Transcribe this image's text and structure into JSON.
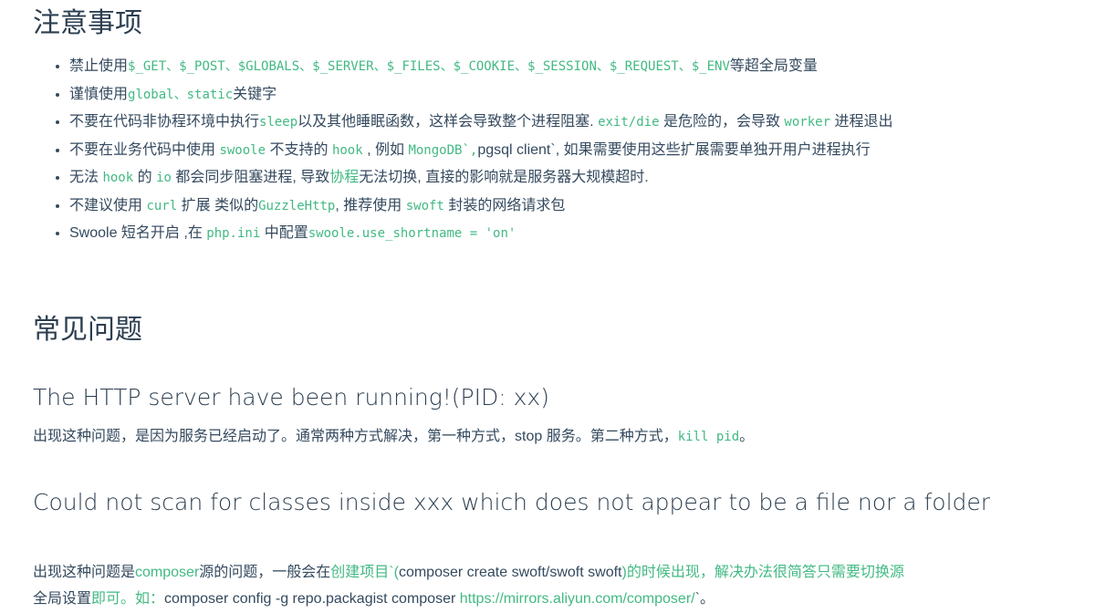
{
  "notes": {
    "title": "注意事项",
    "items": [
      {
        "t1": "禁止使用",
        "c1": "$_GET、$_POST、$GLOBALS、$_SERVER、$_FILES、$_COOKIE、$_SESSION、$_REQUEST、$_ENV",
        "t2": "等超全局变量"
      },
      {
        "t1": "谨慎使用",
        "c1": "global、static",
        "t2": "关键字"
      },
      {
        "t1": "不要在代码非协程环境中执行",
        "c1": "sleep",
        "t2": "以及其他睡眠函数，这样会导致整个进程阻塞. ",
        "c2": "exit/die",
        "t3": " 是危险的，会导致 ",
        "c3": "worker",
        "t4": " 进程退出"
      },
      {
        "t1": "不要在业务代码中使用 ",
        "c1": "swoole",
        "t2": " 不支持的 ",
        "c2": "hook",
        "t3": " , 例如 ",
        "c3": "MongoDB`,",
        "t4": "pgsql client`, 如果需要使用这些扩展需要单独开用户进程执行"
      },
      {
        "t1": "无法 ",
        "c1": "hook",
        "t2": " 的 ",
        "c2": "io",
        "t3": " 都会同步阻塞进程, 导致",
        "g1": "协程",
        "t4": "无法切换, 直接的影响就是服务器大规模超时."
      },
      {
        "t1": "不建议使用 ",
        "c1": "curl",
        "t2": " 扩展 类似的",
        "c2": "GuzzleHttp",
        "t3": ", 推荐使用 ",
        "c3": "swoft",
        "t4": " 封装的网络请求包"
      },
      {
        "t1": "Swoole 短名开启 ,在 ",
        "c1": "php.ini",
        "t2": " 中配置",
        "c2": "swoole.use_shortname = 'on'"
      }
    ]
  },
  "faq": {
    "title": "常见问题",
    "q1": {
      "title": "The HTTP server have been running!(PID: xx)",
      "text": "出现这种问题，是因为服务已经启动了。通常两种方式解决，第一种方式，stop 服务。第二种方式，",
      "code": "kill pid",
      "end": "。"
    },
    "q2": {
      "title": "Could not scan for classes inside xxx which does not appear to be a file nor a folder",
      "t1": "出现这种问题是",
      "g1": "composer",
      "t2": "源的问题，一般会在",
      "g2": "创建项目`(",
      "t3": "composer create swoft/swoft swoft",
      "g3": ")的时候出现，解决办法很简答只需要切换源",
      "t4": "全局设置",
      "g4": "即可。如：",
      "t5": "composer config -g repo.packagist composer ",
      "link": "https://mirrors.aliyun.com/composer/",
      "t6": "`。"
    }
  }
}
